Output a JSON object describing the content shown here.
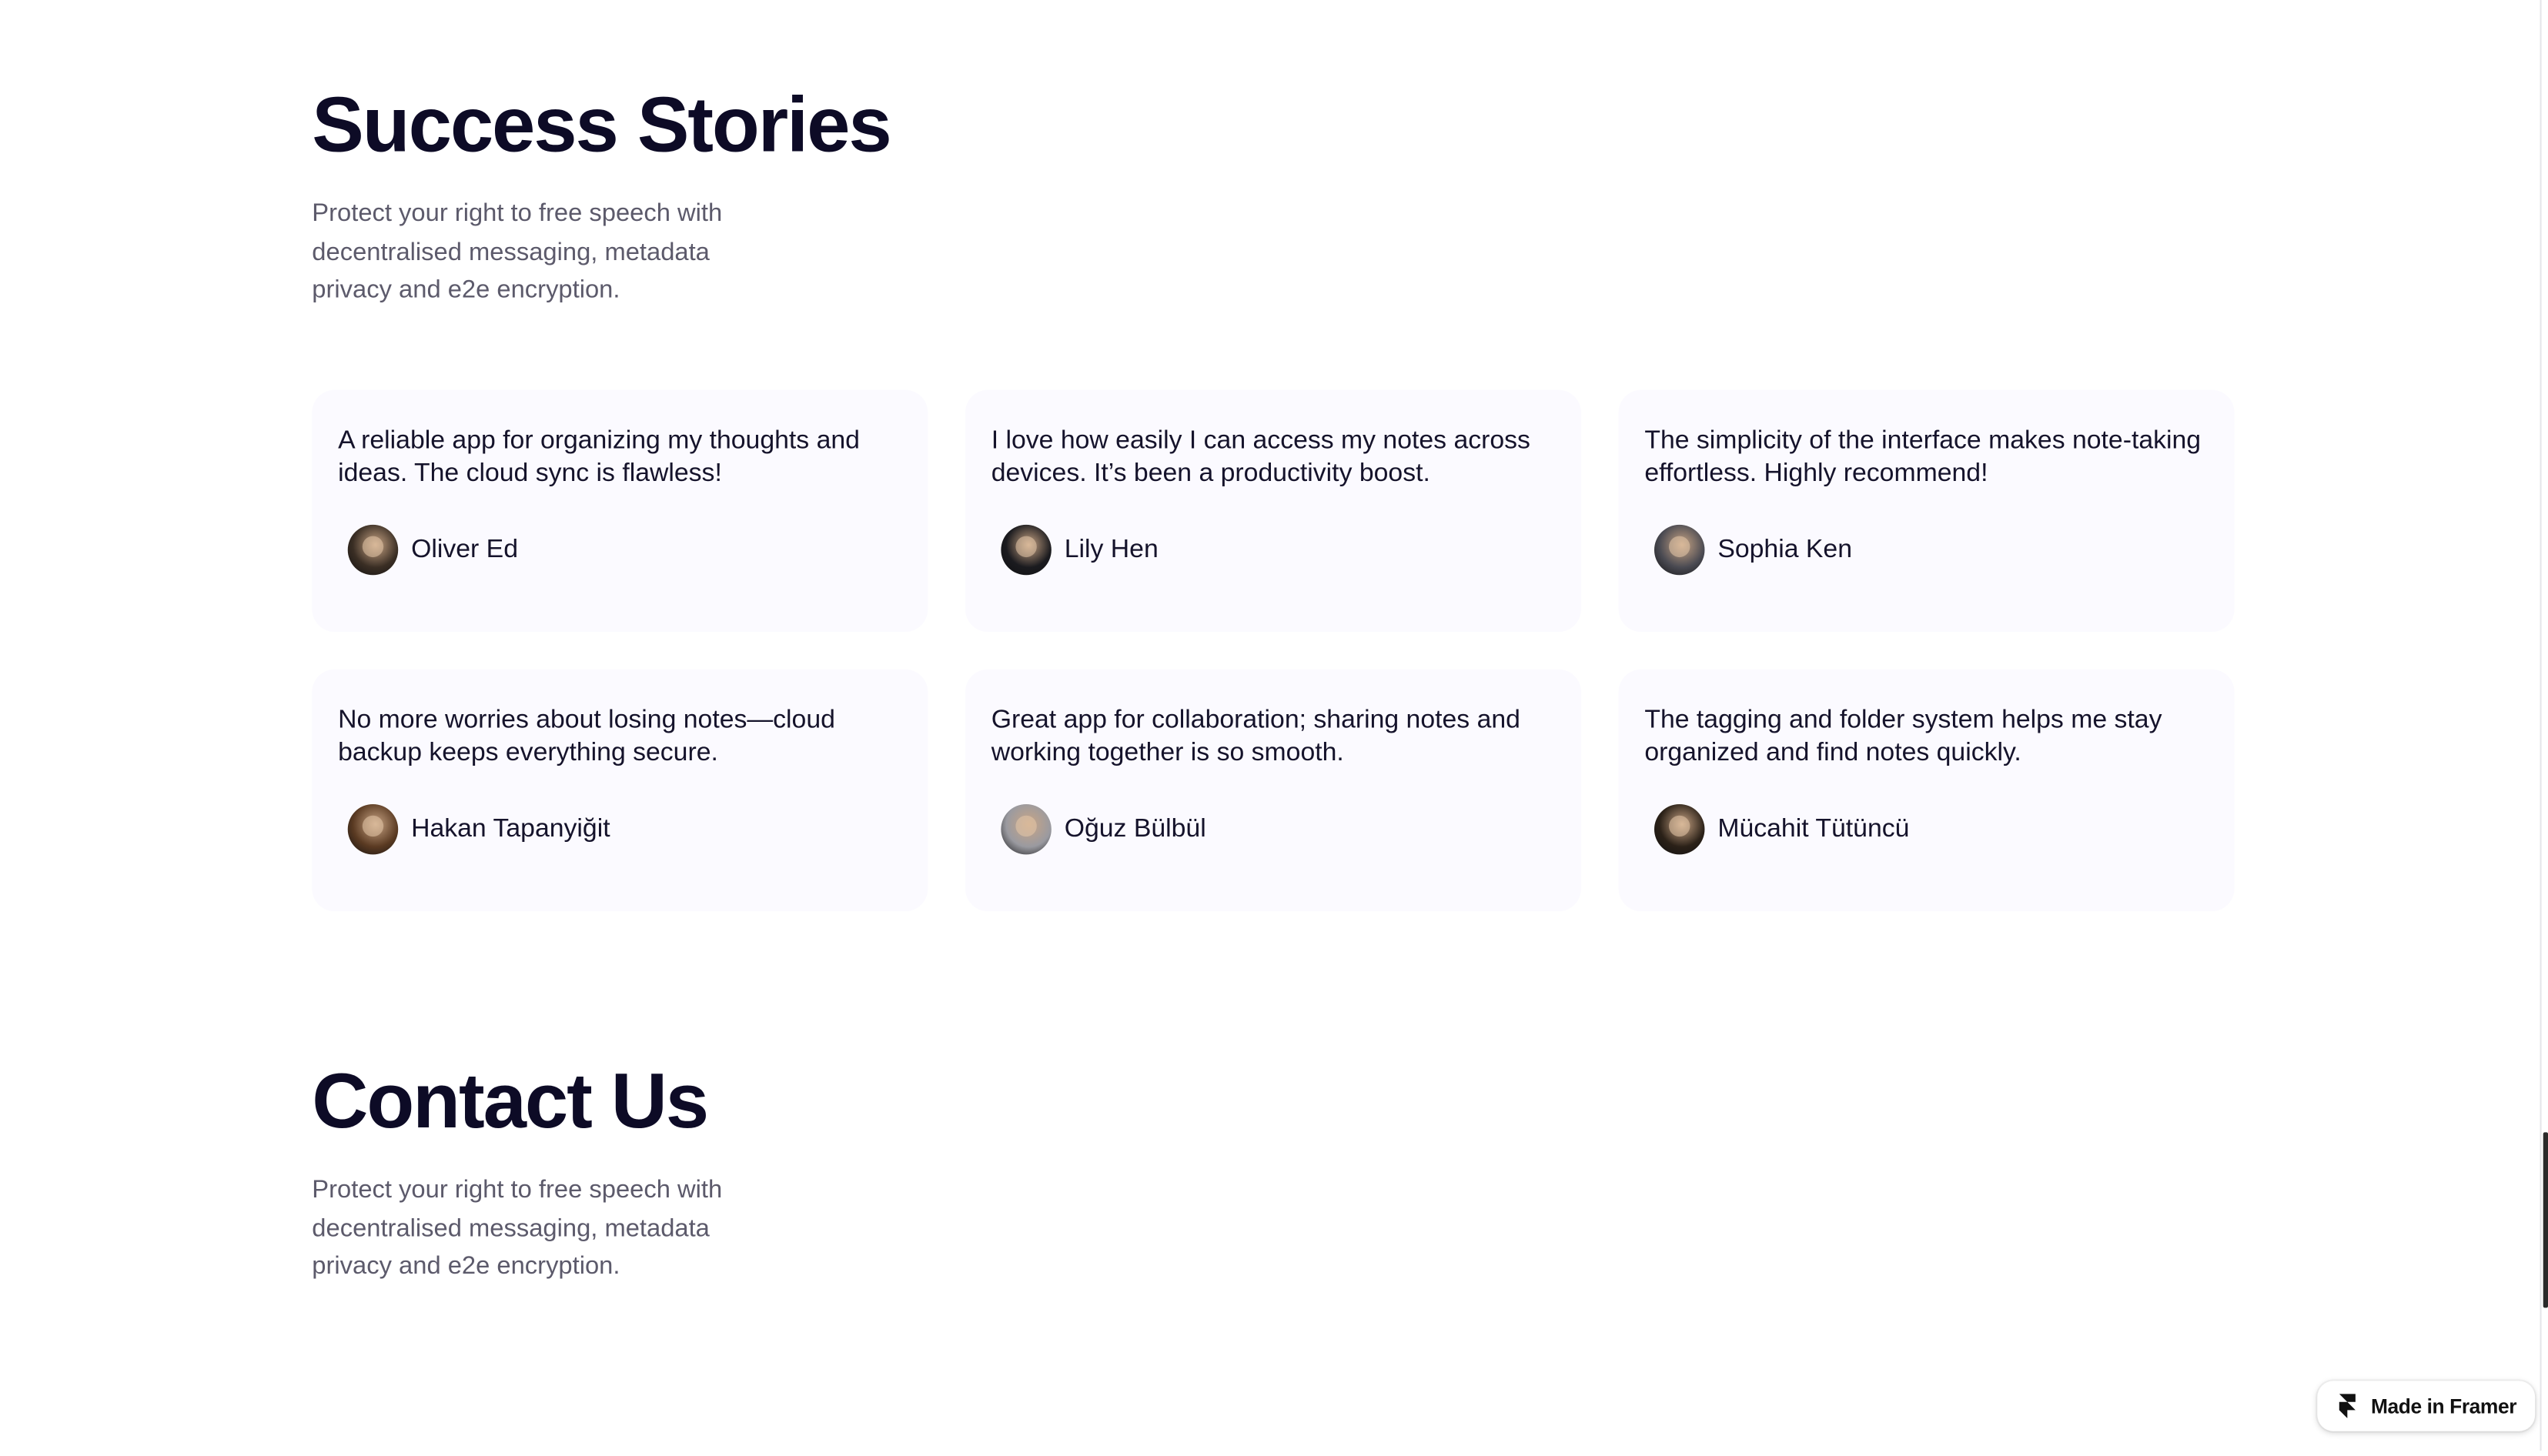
{
  "success_stories": {
    "title": "Success Stories",
    "description": "Protect your right to free speech with decentralised messaging, metadata privacy and e2e encryption.",
    "testimonials": [
      {
        "quote": "A reliable app for organizing my thoughts and ideas. The cloud sync is flawless!",
        "author": "Oliver Ed",
        "avatar_color": "#3a2e24"
      },
      {
        "quote": "I love how easily I can access my notes across devices. It’s been a productivity boost.",
        "author": "Lily Hen",
        "avatar_color": "#1b1b1f"
      },
      {
        "quote": "The simplicity of the interface makes note-taking effortless. Highly recommend!",
        "author": "Sophia Ken",
        "avatar_color": "#4a4a52"
      },
      {
        "quote": "No more worries about losing notes—cloud backup keeps everything secure.",
        "author": "Hakan Tapanyiğit",
        "avatar_color": "#5a3a22"
      },
      {
        "quote": "Great app for collaboration; sharing notes and working together is so smooth.",
        "author": "Oğuz Bülbül",
        "avatar_color": "#9a9aa0"
      },
      {
        "quote": "The tagging and folder system helps me stay organized and find notes quickly.",
        "author": "Mücahit Tütüncü",
        "avatar_color": "#2b2118"
      }
    ]
  },
  "contact": {
    "title": "Contact Us",
    "description": "Protect your right to free speech with decentralised messaging, metadata privacy and e2e encryption."
  },
  "badge": {
    "label": "Made in Framer",
    "icon": "framer-logo-icon"
  },
  "colors": {
    "heading": "#0d0b26",
    "body_text": "#5c5a6b",
    "card_background": "#fbfaff"
  }
}
